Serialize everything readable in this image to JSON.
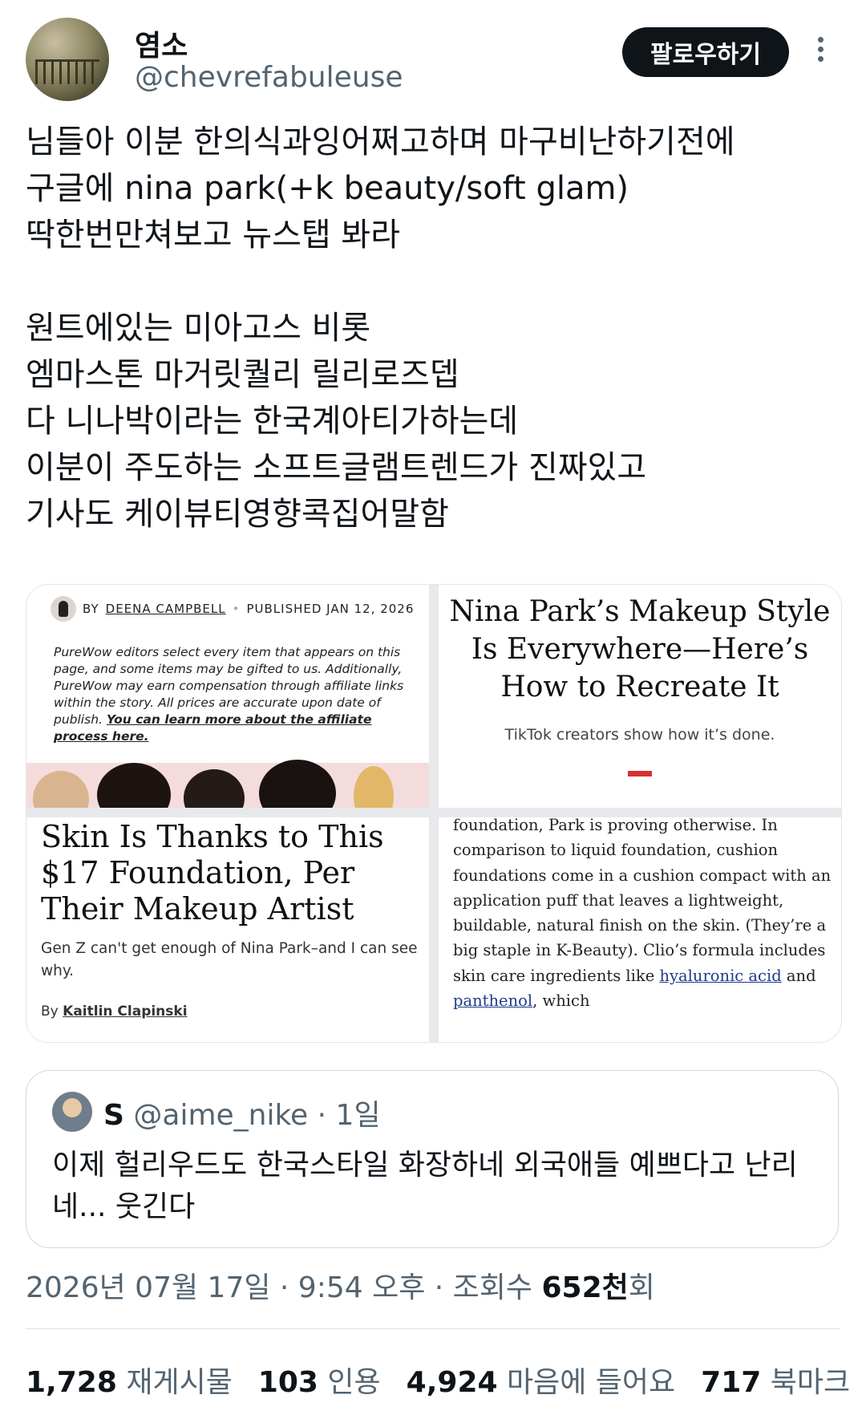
{
  "author": {
    "display_name": "염소",
    "handle": "@chevrefabuleuse",
    "follow_label": "팔로우하기",
    "more_icon": "more-vertical-icon"
  },
  "tweet": {
    "lines_a": [
      "님들아 이분 한의식과잉어쩌고하며 마구비난하기전에",
      "구글에 nina park(+k beauty/soft glam)",
      "딱한번만쳐보고 뉴스탭 봐라"
    ],
    "lines_b": [
      "원트에있는 미아고스 비롯",
      "엠마스톤 마거릿퀄리 릴리로즈뎁",
      "다 니나박이라는 한국계아티가하는데",
      "이분이 주도하는 소프트글램트렌드가 진짜있고",
      "기사도 케이뷰티영향콕집어말함"
    ]
  },
  "media": {
    "tile1": {
      "by_prefix": "BY",
      "author": "DEENA CAMPBELL",
      "separator": "•",
      "published": "PUBLISHED JAN 12, 2026",
      "disclaimer": "PureWow editors select every item that appears on this page, and some items may be gifted to us. Additionally, PureWow may earn compensation through affiliate links within the story. All prices are accurate upon date of publish.",
      "disclaimer_link": "You can learn more about the affiliate process here."
    },
    "tile2": {
      "title": "Nina Park’s Makeup Style Is Everywhere—Here’s How to Recreate It",
      "subtitle": "TikTok creators show how it’s done."
    },
    "tile3": {
      "title": "Skin Is Thanks to This $17 Foundation, Per Their Makeup Artist",
      "dek": "Gen Z can't get enough of Nina Park–and I can see why.",
      "by_prefix": "By",
      "author": "Kaitlin Clapinski"
    },
    "tile4": {
      "text_1": "foundation, Park is proving otherwise. In comparison to liquid foundation, cushion foundations come in a cushion compact with an application puff that leaves a lightweight, buildable, natural finish on the skin. (They’re a big staple in K-Beauty). Clio’s formula includes skin care ingredients like ",
      "link_1": "hyaluronic acid",
      "text_2": " and ",
      "link_2": "panthenol",
      "text_3": ", which"
    }
  },
  "quote": {
    "name": "S",
    "handle": "@aime_nike",
    "time": "· 1일",
    "text": "이제 헐리우드도 한국스타일 화장하네 외국애들 예쁘다고 난리네... 웃긴다"
  },
  "meta": {
    "timestamp": "2026년 07월 17일 · 9:54 오후 · 조회수",
    "views": "652천",
    "views_suffix": "회"
  },
  "stats": {
    "reposts_count": "1,728",
    "reposts_label": "재게시물",
    "quotes_count": "103",
    "quotes_label": "인용",
    "likes_count": "4,924",
    "likes_label": "마음에 들어요",
    "bookmarks_count": "717",
    "bookmarks_label": "북마크"
  },
  "colors": {
    "text": "#0f1419",
    "secondary": "#536471",
    "border": "#cfd9de",
    "accent_red": "#d9302f",
    "link_blue": "#1f3b8a"
  }
}
